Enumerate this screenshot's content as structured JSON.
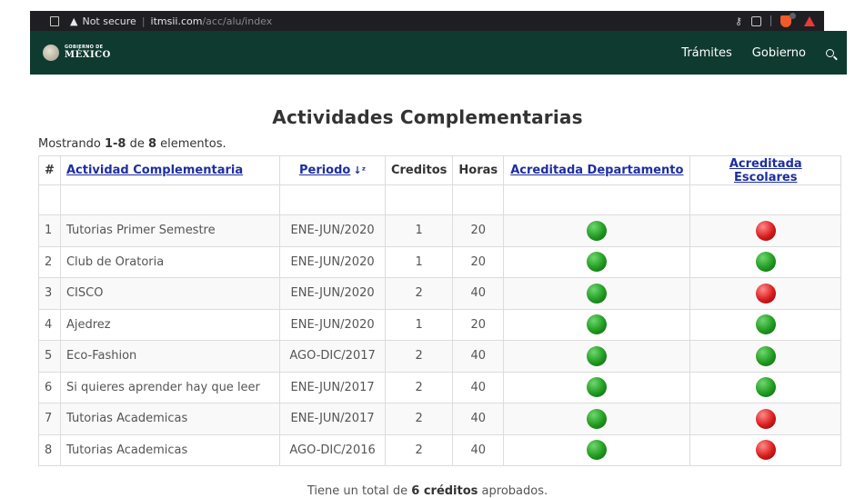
{
  "browser": {
    "not_secure": "Not secure",
    "separator": "|",
    "host": "itmsii.com",
    "path": "/acc/alu/index"
  },
  "header": {
    "logo_small": "GOBIERNO DE",
    "logo_big": "MÉXICO",
    "nav": [
      "Trámites",
      "Gobierno"
    ]
  },
  "page": {
    "title": "Actividades Complementarias",
    "summary_prefix": "Mostrando ",
    "summary_range": "1-8",
    "summary_mid": " de ",
    "summary_total": "8",
    "summary_suffix": " elementos."
  },
  "table": {
    "headers": {
      "num": "#",
      "actividad": "Actividad Complementaria",
      "periodo": "Periodo",
      "creditos": "Creditos",
      "horas": "Horas",
      "acred_depto": "Acreditada Departamento",
      "acred_esc": "Acreditada Escolares"
    },
    "rows": [
      {
        "num": "1",
        "actividad": "Tutorias Primer Semestre",
        "periodo": "ENE-JUN/2020",
        "creditos": "1",
        "horas": "20",
        "depto": "ok",
        "esc": "no"
      },
      {
        "num": "2",
        "actividad": "Club de Oratoria",
        "periodo": "ENE-JUN/2020",
        "creditos": "1",
        "horas": "20",
        "depto": "ok",
        "esc": "ok"
      },
      {
        "num": "3",
        "actividad": "CISCO",
        "periodo": "ENE-JUN/2020",
        "creditos": "2",
        "horas": "40",
        "depto": "ok",
        "esc": "no"
      },
      {
        "num": "4",
        "actividad": "Ajedrez",
        "periodo": "ENE-JUN/2020",
        "creditos": "1",
        "horas": "20",
        "depto": "ok",
        "esc": "ok"
      },
      {
        "num": "5",
        "actividad": "Eco-Fashion",
        "periodo": "AGO-DIC/2017",
        "creditos": "2",
        "horas": "40",
        "depto": "ok",
        "esc": "ok"
      },
      {
        "num": "6",
        "actividad": "Si quieres aprender hay que leer",
        "periodo": "ENE-JUN/2017",
        "creditos": "2",
        "horas": "40",
        "depto": "ok",
        "esc": "ok"
      },
      {
        "num": "7",
        "actividad": "Tutorias Academicas",
        "periodo": "ENE-JUN/2017",
        "creditos": "2",
        "horas": "40",
        "depto": "ok",
        "esc": "no"
      },
      {
        "num": "8",
        "actividad": "Tutorias Academicas",
        "periodo": "AGO-DIC/2016",
        "creditos": "2",
        "horas": "40",
        "depto": "ok",
        "esc": "no"
      }
    ]
  },
  "footer": {
    "prefix": "Tiene un total de ",
    "bold": "6 créditos",
    "suffix": " aprobados."
  },
  "colors": {
    "header_bg": "#0f3a2f",
    "link": "#1e2ea0",
    "ok": "#1f9a1f",
    "no": "#d81b1b"
  }
}
